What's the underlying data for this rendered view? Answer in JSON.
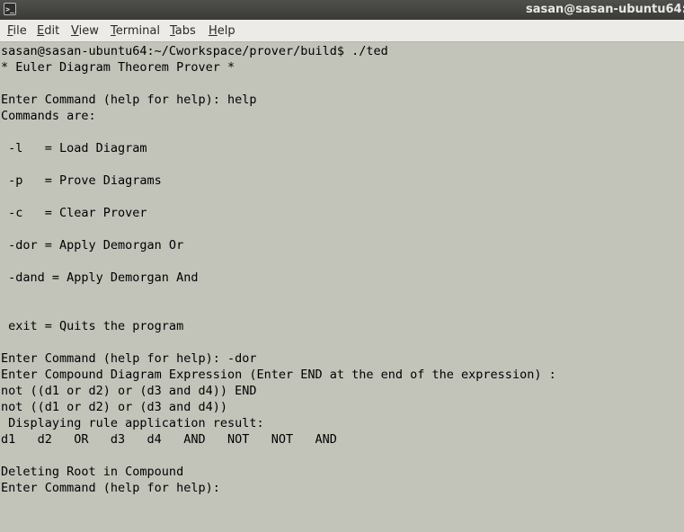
{
  "window": {
    "title": "sasan@sasan-ubuntu64:",
    "icon": "terminal-icon",
    "icon_glyph": ">_"
  },
  "menu": {
    "file": "File",
    "edit": "Edit",
    "view": "View",
    "terminal": "Terminal",
    "tabs": "Tabs",
    "help": "Help"
  },
  "colors": {
    "terminal_background": "#c2c4ba",
    "terminal_foreground": "#000000",
    "titlebar": "#3f3f3c",
    "menubar": "#ecebe7"
  },
  "terminal": {
    "lines": [
      "sasan@sasan-ubuntu64:~/Cworkspace/prover/build$ ./ted",
      "* Euler Diagram Theorem Prover *",
      "",
      "Enter Command (help for help): help",
      "Commands are:",
      "",
      " -l   = Load Diagram",
      "",
      " -p   = Prove Diagrams",
      "",
      " -c   = Clear Prover",
      "",
      " -dor = Apply Demorgan Or",
      "",
      " -dand = Apply Demorgan And",
      "",
      "",
      " exit = Quits the program",
      "",
      "Enter Command (help for help): -dor",
      "Enter Compound Diagram Expression (Enter END at the end of the expression) :",
      "not ((d1 or d2) or (d3 and d4)) END",
      "not ((d1 or d2) or (d3 and d4))",
      " Displaying rule application result:",
      "d1   d2   OR   d3   d4   AND   NOT   NOT   AND",
      "",
      "Deleting Root in Compound",
      "Enter Command (help for help): "
    ]
  }
}
